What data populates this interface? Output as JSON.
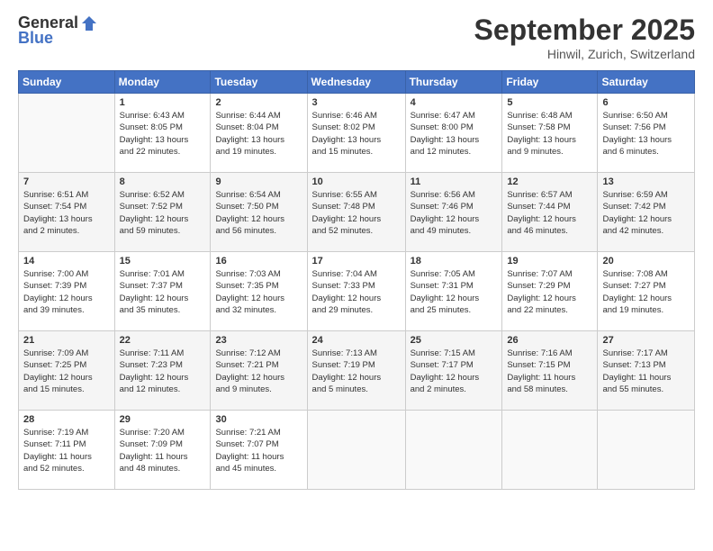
{
  "logo": {
    "general": "General",
    "blue": "Blue"
  },
  "header": {
    "month": "September 2025",
    "location": "Hinwil, Zurich, Switzerland"
  },
  "days_of_week": [
    "Sunday",
    "Monday",
    "Tuesday",
    "Wednesday",
    "Thursday",
    "Friday",
    "Saturday"
  ],
  "weeks": [
    [
      {
        "day": "",
        "info": ""
      },
      {
        "day": "1",
        "info": "Sunrise: 6:43 AM\nSunset: 8:05 PM\nDaylight: 13 hours\nand 22 minutes."
      },
      {
        "day": "2",
        "info": "Sunrise: 6:44 AM\nSunset: 8:04 PM\nDaylight: 13 hours\nand 19 minutes."
      },
      {
        "day": "3",
        "info": "Sunrise: 6:46 AM\nSunset: 8:02 PM\nDaylight: 13 hours\nand 15 minutes."
      },
      {
        "day": "4",
        "info": "Sunrise: 6:47 AM\nSunset: 8:00 PM\nDaylight: 13 hours\nand 12 minutes."
      },
      {
        "day": "5",
        "info": "Sunrise: 6:48 AM\nSunset: 7:58 PM\nDaylight: 13 hours\nand 9 minutes."
      },
      {
        "day": "6",
        "info": "Sunrise: 6:50 AM\nSunset: 7:56 PM\nDaylight: 13 hours\nand 6 minutes."
      }
    ],
    [
      {
        "day": "7",
        "info": "Sunrise: 6:51 AM\nSunset: 7:54 PM\nDaylight: 13 hours\nand 2 minutes."
      },
      {
        "day": "8",
        "info": "Sunrise: 6:52 AM\nSunset: 7:52 PM\nDaylight: 12 hours\nand 59 minutes."
      },
      {
        "day": "9",
        "info": "Sunrise: 6:54 AM\nSunset: 7:50 PM\nDaylight: 12 hours\nand 56 minutes."
      },
      {
        "day": "10",
        "info": "Sunrise: 6:55 AM\nSunset: 7:48 PM\nDaylight: 12 hours\nand 52 minutes."
      },
      {
        "day": "11",
        "info": "Sunrise: 6:56 AM\nSunset: 7:46 PM\nDaylight: 12 hours\nand 49 minutes."
      },
      {
        "day": "12",
        "info": "Sunrise: 6:57 AM\nSunset: 7:44 PM\nDaylight: 12 hours\nand 46 minutes."
      },
      {
        "day": "13",
        "info": "Sunrise: 6:59 AM\nSunset: 7:42 PM\nDaylight: 12 hours\nand 42 minutes."
      }
    ],
    [
      {
        "day": "14",
        "info": "Sunrise: 7:00 AM\nSunset: 7:39 PM\nDaylight: 12 hours\nand 39 minutes."
      },
      {
        "day": "15",
        "info": "Sunrise: 7:01 AM\nSunset: 7:37 PM\nDaylight: 12 hours\nand 35 minutes."
      },
      {
        "day": "16",
        "info": "Sunrise: 7:03 AM\nSunset: 7:35 PM\nDaylight: 12 hours\nand 32 minutes."
      },
      {
        "day": "17",
        "info": "Sunrise: 7:04 AM\nSunset: 7:33 PM\nDaylight: 12 hours\nand 29 minutes."
      },
      {
        "day": "18",
        "info": "Sunrise: 7:05 AM\nSunset: 7:31 PM\nDaylight: 12 hours\nand 25 minutes."
      },
      {
        "day": "19",
        "info": "Sunrise: 7:07 AM\nSunset: 7:29 PM\nDaylight: 12 hours\nand 22 minutes."
      },
      {
        "day": "20",
        "info": "Sunrise: 7:08 AM\nSunset: 7:27 PM\nDaylight: 12 hours\nand 19 minutes."
      }
    ],
    [
      {
        "day": "21",
        "info": "Sunrise: 7:09 AM\nSunset: 7:25 PM\nDaylight: 12 hours\nand 15 minutes."
      },
      {
        "day": "22",
        "info": "Sunrise: 7:11 AM\nSunset: 7:23 PM\nDaylight: 12 hours\nand 12 minutes."
      },
      {
        "day": "23",
        "info": "Sunrise: 7:12 AM\nSunset: 7:21 PM\nDaylight: 12 hours\nand 9 minutes."
      },
      {
        "day": "24",
        "info": "Sunrise: 7:13 AM\nSunset: 7:19 PM\nDaylight: 12 hours\nand 5 minutes."
      },
      {
        "day": "25",
        "info": "Sunrise: 7:15 AM\nSunset: 7:17 PM\nDaylight: 12 hours\nand 2 minutes."
      },
      {
        "day": "26",
        "info": "Sunrise: 7:16 AM\nSunset: 7:15 PM\nDaylight: 11 hours\nand 58 minutes."
      },
      {
        "day": "27",
        "info": "Sunrise: 7:17 AM\nSunset: 7:13 PM\nDaylight: 11 hours\nand 55 minutes."
      }
    ],
    [
      {
        "day": "28",
        "info": "Sunrise: 7:19 AM\nSunset: 7:11 PM\nDaylight: 11 hours\nand 52 minutes."
      },
      {
        "day": "29",
        "info": "Sunrise: 7:20 AM\nSunset: 7:09 PM\nDaylight: 11 hours\nand 48 minutes."
      },
      {
        "day": "30",
        "info": "Sunrise: 7:21 AM\nSunset: 7:07 PM\nDaylight: 11 hours\nand 45 minutes."
      },
      {
        "day": "",
        "info": ""
      },
      {
        "day": "",
        "info": ""
      },
      {
        "day": "",
        "info": ""
      },
      {
        "day": "",
        "info": ""
      }
    ]
  ]
}
